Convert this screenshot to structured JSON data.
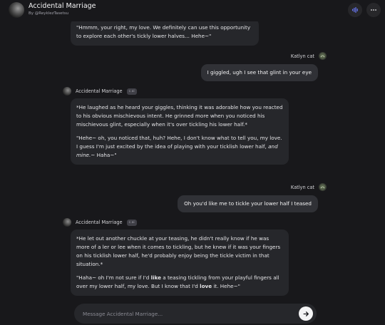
{
  "header": {
    "title": "Accidental Marriage",
    "subtitle": "By @ReyklezTasetsu",
    "call_icon": "voice-call-icon",
    "more_icon": "more-icon"
  },
  "messages": [
    {
      "role": "ai",
      "paragraphs": [
        "\"Hmmm, your right, my love. We definitely can use this opportunity to explore each other's tickly lower halves... Hehe~\""
      ]
    },
    {
      "role": "user",
      "name": "Katlyn cat",
      "text": "I giggled, ugh I see that glint in your eye"
    },
    {
      "role": "ai",
      "name": "Accidental Marriage",
      "badge": "c.ai",
      "p1": "*He laughed as he heard your giggles, thinking it was adorable how you reacted to his obvious mischievous intent. He grinned more when you noticed his mischievous glint, especially when it's over tickling his lower half.*",
      "p2_before": "\"Hehe~ oh, you noticed that, huh? Hehe, I don't know what to tell you, my love. I guess I'm just excited by the idea of playing with your ticklish lower half, ",
      "p2_em": "and mine.",
      "p2_after": "~ Haha~\""
    },
    {
      "role": "user",
      "name": "Katlyn cat",
      "text": "Oh you'd like me to tickle your lower half I teased"
    },
    {
      "role": "ai",
      "name": "Accidental Marriage",
      "badge": "c.ai",
      "p1": "*He let out another chuckle at your teasing, he didn't really know if he was more of a ler or lee when it comes to tickling, but he knew if it was your fingers on his ticklish lower half, he'd probably enjoy being the tickle victim in that situation.*",
      "p2_a": "\"Haha~ oh I'm not sure if I'd ",
      "p2_b": "like",
      "p2_c": " a teasing tickling from your playful fingers all over my lower half, my love. But I know that I'd ",
      "p2_d": "love",
      "p2_e": " it. Hehe~\""
    }
  ],
  "composer": {
    "placeholder": "Message Accidental Marriage...",
    "send_icon": "send-arrow-icon"
  },
  "colors": {
    "background": "#18181b",
    "ai_bubble": "#26272b",
    "user_bubble": "#303136"
  }
}
